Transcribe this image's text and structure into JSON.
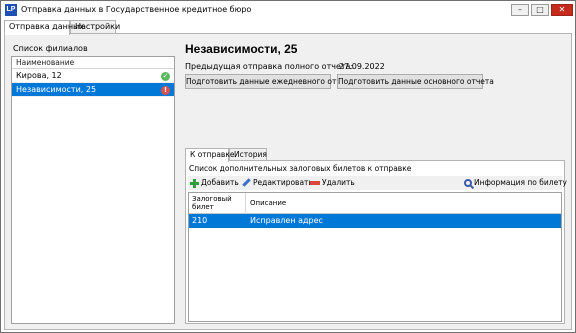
{
  "window": {
    "title": "Отправка данных в Государственное кредитное бюро",
    "icon_text": "LP",
    "controls": [
      "minimize",
      "maximize",
      "close"
    ]
  },
  "main_tabs": [
    {
      "label": "Отправка данных",
      "active": true
    },
    {
      "label": "Настройки",
      "active": false
    }
  ],
  "branches": {
    "group_label": "Список филиалов",
    "column_header": "Наименование",
    "items": [
      {
        "name": "Кирова, 12",
        "status": "ok",
        "status_icon": "check-circle-icon",
        "selected": false
      },
      {
        "name": "Независимости, 25",
        "status": "error",
        "status_icon": "error-circle-icon",
        "selected": true
      }
    ]
  },
  "detail": {
    "title": "Независимости, 25",
    "prev_full_report_label": "Предыдущая отправка полного отчета:",
    "prev_full_report_date": "27.09.2022",
    "btn_daily": "Подготовить данные ежедневного отчета",
    "btn_main": "Подготовить данные основного отчета"
  },
  "inner_tabs": [
    {
      "label": "К отправке",
      "active": true
    },
    {
      "label": "История",
      "active": false
    }
  ],
  "pledge": {
    "list_label": "Список дополнительных залоговых билетов к отправке",
    "toolbar": {
      "add": "Добавить",
      "edit": "Редактировать",
      "delete": "Удалить",
      "info": "Информация по билету"
    },
    "columns": [
      "Залоговый билет",
      "Описание"
    ],
    "rows": [
      {
        "ticket": "210",
        "description": "Исправлен адрес",
        "selected": true
      }
    ]
  },
  "colors": {
    "selection": "#0078d7",
    "ok": "#5cb85c",
    "error": "#d9534f",
    "close_button": "#c42b1c"
  }
}
